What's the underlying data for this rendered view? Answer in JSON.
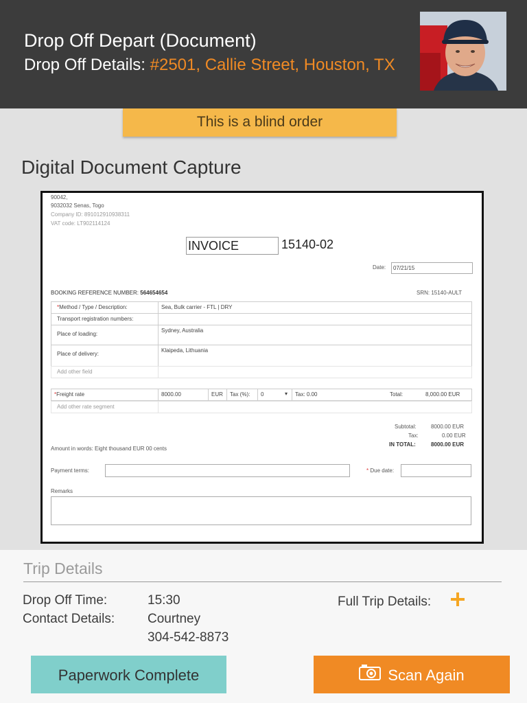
{
  "header": {
    "title": "Drop Off Depart (Document)",
    "details_label": "Drop Off Details:",
    "address": "#2501, Callie Street, Houston, TX"
  },
  "banner": {
    "text": "This is a blind order"
  },
  "capture": {
    "title": "Digital Document Capture"
  },
  "document": {
    "sender_lines": [
      "90042,",
      "9032032 Senas, Togo",
      "Company ID: 891012910938311",
      "VAT code: LT902114124"
    ],
    "invoice_label": "INVOICE",
    "invoice_number": "15140-02",
    "date_label": "Date:",
    "date_value": "07/21/15",
    "booking_label": "BOOKING REFERENCE NUMBER:",
    "booking_value": "564654654",
    "srn": "SRN: 15140-AULT",
    "rows": [
      {
        "label": "Method / Type / Description:",
        "value": "Sea, Bulk carrier - FTL | DRY",
        "required": "*"
      },
      {
        "label": "Transport registration numbers:",
        "value": "",
        "required": ""
      },
      {
        "label": "Place of loading:",
        "value": "Sydney, Australia",
        "required": ""
      },
      {
        "label": "Place of delivery:",
        "value": "Klaipeda, Lithuania",
        "required": ""
      },
      {
        "label": "Add other field",
        "value": "",
        "required": ""
      }
    ],
    "freight": {
      "required": "*",
      "label": "Freight rate",
      "amount": "8000.00",
      "currency": "EUR",
      "tax_label": "Tax (%):",
      "tax_value": "0",
      "tax_amount": "Tax: 0.00",
      "total_label": "Total:",
      "total_value": "8,000.00 EUR",
      "add_segment": "Add other rate segment"
    },
    "totals": {
      "subtotal_label": "Subtotal:",
      "subtotal_value": "8000.00 EUR",
      "tax_label": "Tax:",
      "tax_value": "0.00 EUR",
      "total_label": "IN TOTAL:",
      "total_value": "8000.00 EUR"
    },
    "amount_words": "Amount in words: Eight thousand EUR 00 cents",
    "payment_terms_label": "Payment terms:",
    "due_date_required": "*",
    "due_date_label": "Due date:",
    "remarks_label": "Remarks"
  },
  "trip": {
    "title": "Trip Details",
    "drop_off_time_label": "Drop Off Time:",
    "drop_off_time": "15:30",
    "contact_label": "Contact Details:",
    "contact_name": "Courtney",
    "contact_phone": "304-542-8873",
    "full_trip_label": "Full Trip Details:"
  },
  "buttons": {
    "complete": "Paperwork Complete",
    "scan": "Scan Again"
  },
  "colors": {
    "header_bg": "#3c3c3c",
    "accent": "#f08a24",
    "banner": "#f5b84a",
    "teal": "#80cfcb"
  }
}
